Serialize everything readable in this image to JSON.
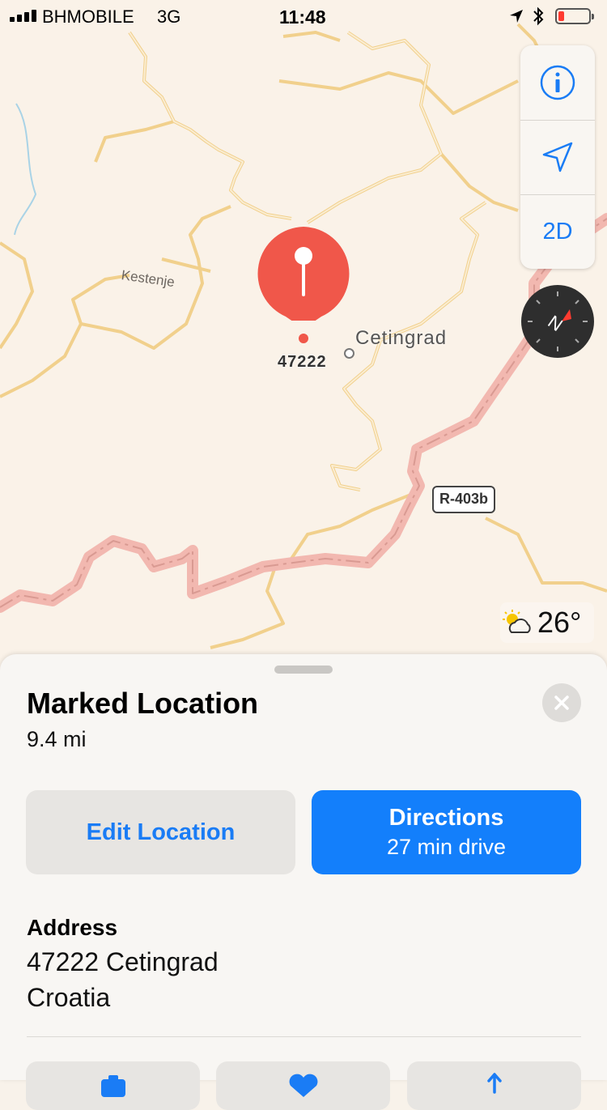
{
  "status_bar": {
    "carrier": "BHMOBILE",
    "network": "3G",
    "time": "11:48",
    "battery_level": 0.2,
    "icons": [
      "signal-bars-icon",
      "location-arrow-icon",
      "bluetooth-icon",
      "battery-icon"
    ]
  },
  "map": {
    "pin_label": "47222",
    "town_label": "Cetingrad",
    "village_label": "Kestenje",
    "road_shield": "R-403b",
    "controls": {
      "info_icon": "info-icon",
      "location_icon": "location-arrow-icon",
      "view_mode": "2D"
    },
    "compass_icon": "compass-icon",
    "weather": {
      "icon": "partly-sunny-icon",
      "temperature": "26°"
    },
    "colors": {
      "land": "#faf2e8",
      "minor_road": "#f3d79a",
      "highway": "#f1b7b0",
      "pin": "#f0574a"
    }
  },
  "sheet": {
    "title": "Marked Location",
    "distance": "9.4 mi",
    "close_icon": "close-icon",
    "edit_button": "Edit Location",
    "directions_button": {
      "label": "Directions",
      "sub": "27 min drive"
    },
    "address_heading": "Address",
    "address_line1": "47222 Cetingrad",
    "address_line2": "Croatia",
    "actions": [
      "camera-icon",
      "heart-icon",
      "share-icon"
    ],
    "colors": {
      "accent": "#137ffb",
      "button_gray": "#e7e5e2"
    }
  }
}
